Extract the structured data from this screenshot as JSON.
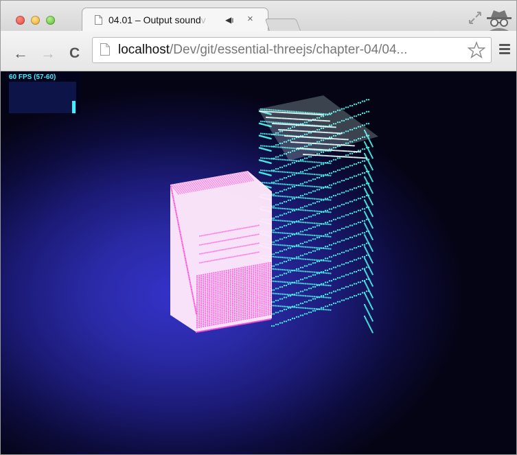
{
  "browser": {
    "tab": {
      "title_visible": "04.01 – Output sound",
      "title_faded": "v",
      "audio_icon": "speaker-icon",
      "close_label": "×"
    },
    "toolbar": {
      "url_host": "localhost",
      "url_path": "/Dev/git/essential-threejs/chapter-04/04...",
      "back_label": "←",
      "forward_label": "→",
      "reload_label": "C"
    }
  },
  "viewport": {
    "fps_text": "60 FPS (57-60)",
    "fps_level": 0.4,
    "scene": {
      "objects": [
        "magenta-particle-cube",
        "cyan-particle-tower"
      ],
      "colors": {
        "magenta": "#ff4fd8",
        "magenta_fill": "#ffe8fb",
        "cyan": "#4ff2ea",
        "background_center": "#3432c9",
        "background_edge": "#050415"
      }
    }
  }
}
